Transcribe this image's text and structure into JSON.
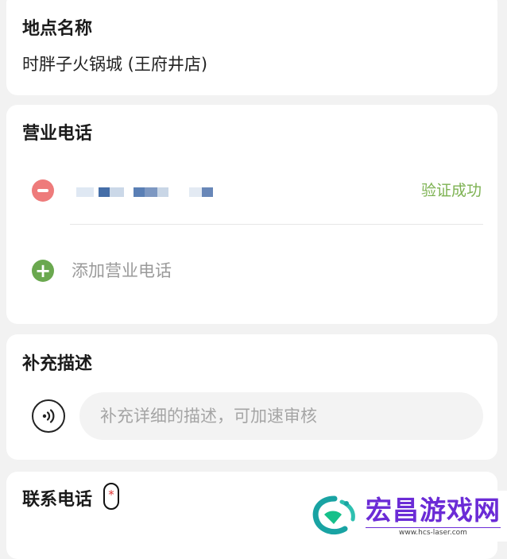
{
  "location": {
    "title": "地点名称",
    "name": "时胖子火锅城 (王府井店)"
  },
  "phone": {
    "title": "营业电话",
    "verify_status": "验证成功",
    "add_label": "添加营业电话",
    "status_color": "#7db252"
  },
  "description": {
    "title": "补充描述",
    "placeholder": "补充详细的描述，可加速审核"
  },
  "contact": {
    "title": "联系电话",
    "required": "*"
  },
  "watermark": {
    "name": "宏昌游戏网",
    "url": "www.hcs-laser.com"
  }
}
